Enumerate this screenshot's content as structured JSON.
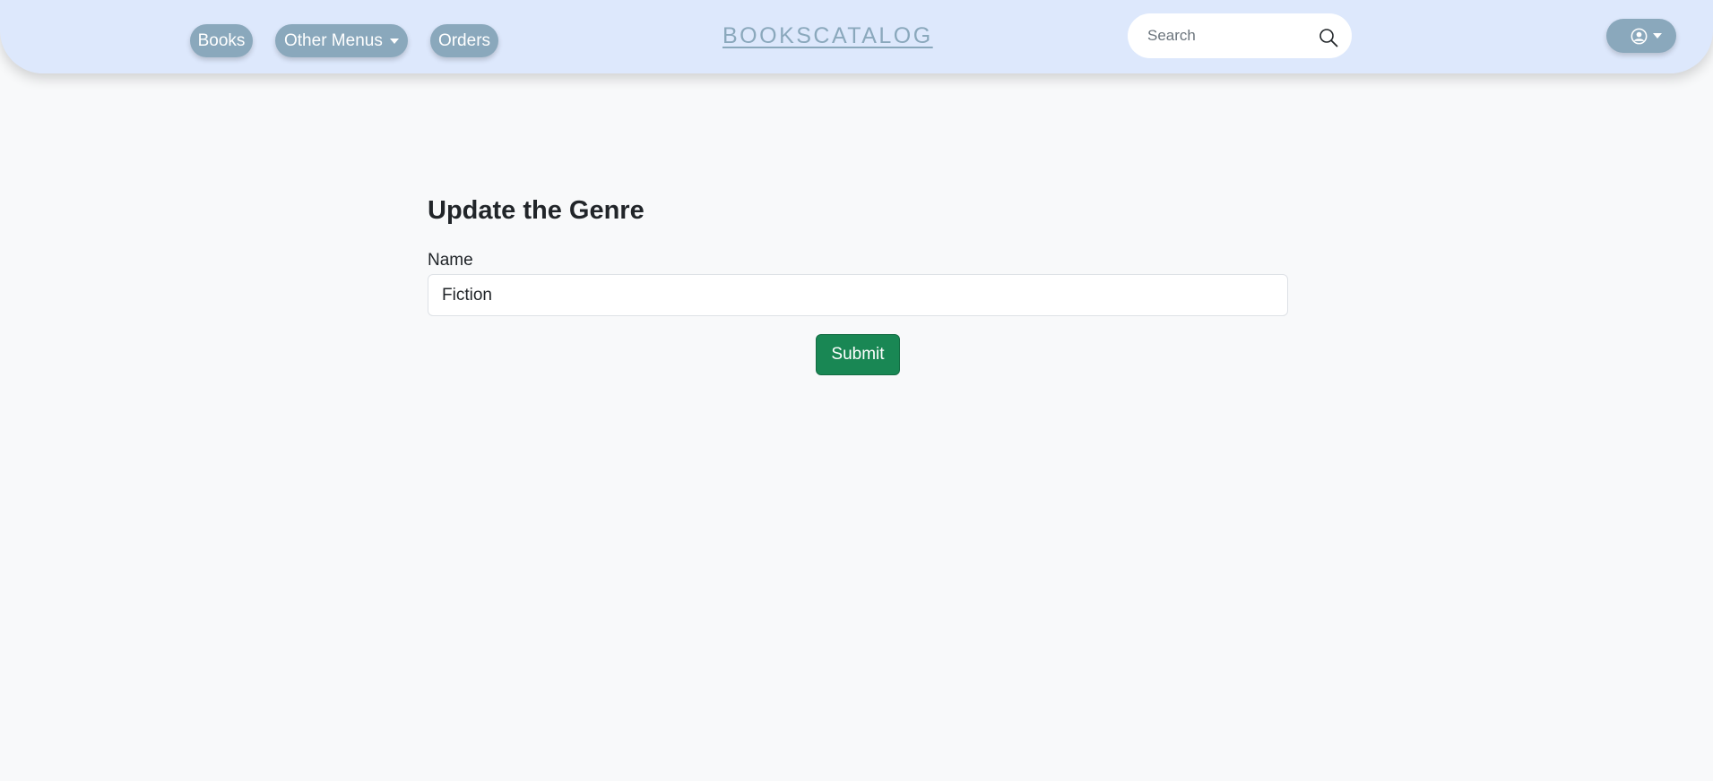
{
  "navbar": {
    "items": [
      {
        "label": "Books"
      },
      {
        "label": "Other Menus"
      },
      {
        "label": "Orders"
      }
    ],
    "brand": "BOOKSCATALOG",
    "search": {
      "placeholder": "Search",
      "value": "",
      "icon": "search-icon"
    },
    "user_menu": {
      "icon": "user-circle-icon",
      "dropdown_icon": "caret-down-icon"
    }
  },
  "form": {
    "title": "Update the Genre",
    "name_label": "Name",
    "name_value": "Fiction",
    "submit_label": "Submit"
  },
  "colors": {
    "navbar_bg": "#dde8fc",
    "pill_bg": "#8aa8bc",
    "brand": "#8aa8bc",
    "page_bg": "#f8f9fa",
    "submit_bg": "#198754"
  }
}
